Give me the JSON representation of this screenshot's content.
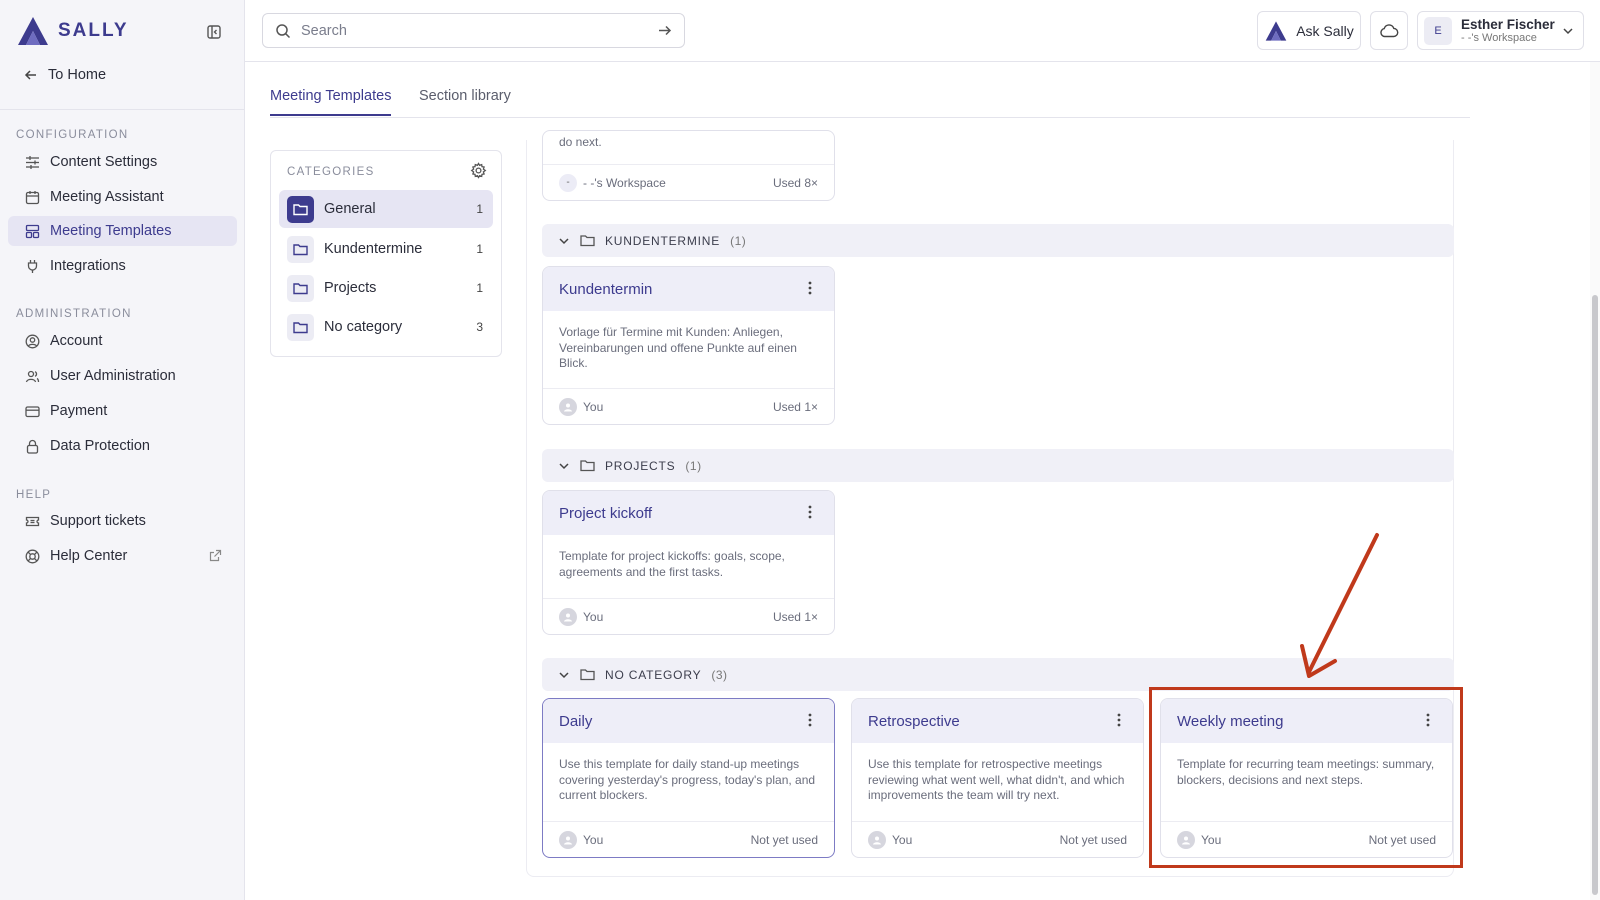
{
  "brand": {
    "name": "SALLY",
    "accent": "#3d3b8e"
  },
  "sidebar": {
    "to_home": "To Home",
    "sections": {
      "configuration": "CONFIGURATION",
      "administration": "ADMINISTRATION",
      "help": "HELP"
    },
    "config_items": [
      {
        "label": "Content Settings",
        "icon": "sliders-icon"
      },
      {
        "label": "Meeting Assistant",
        "icon": "calendar-icon"
      },
      {
        "label": "Meeting Templates",
        "icon": "templates-icon",
        "active": true
      },
      {
        "label": "Integrations",
        "icon": "plug-icon"
      }
    ],
    "admin_items": [
      {
        "label": "Account",
        "icon": "user-circle-icon"
      },
      {
        "label": "User Administration",
        "icon": "users-icon"
      },
      {
        "label": "Payment",
        "icon": "credit-card-icon"
      },
      {
        "label": "Data Protection",
        "icon": "lock-icon"
      }
    ],
    "help_items": [
      {
        "label": "Support tickets",
        "icon": "ticket-icon"
      },
      {
        "label": "Help Center",
        "icon": "lifebuoy-icon"
      }
    ]
  },
  "topbar": {
    "search_placeholder": "Search",
    "ask_sally": "Ask Sally",
    "user": {
      "initial": "E",
      "name": "Esther Fischer",
      "workspace": "- -'s Workspace"
    }
  },
  "tabs": [
    {
      "label": "Meeting Templates",
      "active": true
    },
    {
      "label": "Section library",
      "active": false
    }
  ],
  "categories": {
    "title": "CATEGORIES",
    "items": [
      {
        "label": "General",
        "count": "1",
        "active": true
      },
      {
        "label": "Kundentermine",
        "count": "1"
      },
      {
        "label": "Projects",
        "count": "1"
      },
      {
        "label": "No category",
        "count": "3"
      }
    ]
  },
  "groups": {
    "top_card": {
      "desc_tail": "do next.",
      "workspace_badge": "-",
      "owner": "- -'s Workspace",
      "usage": "Used 8×"
    },
    "kundentermine": {
      "title": "KUNDENTERMINE",
      "count": "(1)",
      "cards": [
        {
          "title": "Kundentermin",
          "desc": "Vorlage für Termine mit Kunden: Anliegen, Vereinbarungen und offene Punkte auf einen Blick.",
          "owner": "You",
          "usage": "Used 1×"
        }
      ]
    },
    "projects": {
      "title": "PROJECTS",
      "count": "(1)",
      "cards": [
        {
          "title": "Project kickoff",
          "desc": "Template for project kickoffs: goals, scope, agreements and the first tasks.",
          "owner": "You",
          "usage": "Used 1×"
        }
      ]
    },
    "no_category": {
      "title": "NO CATEGORY",
      "count": "(3)",
      "cards": [
        {
          "title": "Daily",
          "desc": "Use this template for daily stand-up meetings covering yesterday's progress, today's plan, and current blockers.",
          "owner": "You",
          "usage": "Not yet used"
        },
        {
          "title": "Retrospective",
          "desc": "Use this template for retrospective meetings reviewing what went well, what didn't, and which improvements the team will try next.",
          "owner": "You",
          "usage": "Not yet used"
        },
        {
          "title": "Weekly meeting",
          "desc": "Template for recurring team meetings: summary, blockers, decisions and next steps.",
          "owner": "You",
          "usage": "Not yet used"
        }
      ]
    }
  },
  "annotation": {
    "color": "#c0391b"
  }
}
